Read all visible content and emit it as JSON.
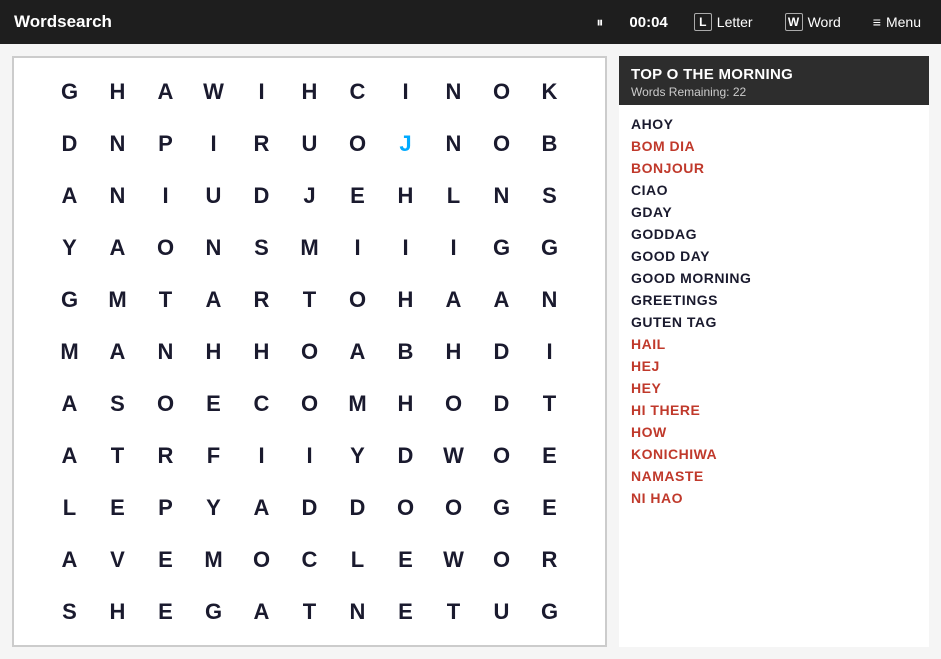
{
  "header": {
    "app_title": "Wordsearch",
    "pause_icon": "⏸",
    "timer": "00:04",
    "letter_label": "Letter",
    "letter_icon": "L",
    "word_label": "Word",
    "word_icon": "W",
    "menu_label": "Menu",
    "menu_icon": "≡"
  },
  "puzzle": {
    "title": "TOP O THE MORNING",
    "words_remaining_label": "Words Remaining: 22"
  },
  "grid": [
    [
      "G",
      "H",
      "A",
      "W",
      "I",
      "H",
      "C",
      "I",
      "N",
      "O",
      "K"
    ],
    [
      "D",
      "N",
      "P",
      "I",
      "R",
      "U",
      "O",
      "J",
      "N",
      "O",
      "B"
    ],
    [
      "A",
      "N",
      "I",
      "U",
      "D",
      "J",
      "E",
      "H",
      "L",
      "N",
      "S"
    ],
    [
      "Y",
      "A",
      "O",
      "N",
      "S",
      "M",
      "I",
      "I",
      "I",
      "G",
      "G"
    ],
    [
      "G",
      "M",
      "T",
      "A",
      "R",
      "T",
      "O",
      "H",
      "A",
      "A",
      "N"
    ],
    [
      "M",
      "A",
      "N",
      "H",
      "H",
      "O",
      "A",
      "B",
      "H",
      "D",
      "I"
    ],
    [
      "A",
      "S",
      "O",
      "E",
      "C",
      "O",
      "M",
      "H",
      "O",
      "D",
      "T"
    ],
    [
      "A",
      "T",
      "R",
      "F",
      "I",
      "I",
      "Y",
      "D",
      "W",
      "O",
      "E"
    ],
    [
      "L",
      "E",
      "P",
      "Y",
      "A",
      "D",
      "D",
      "O",
      "O",
      "G",
      "E"
    ],
    [
      "A",
      "V",
      "E",
      "M",
      "O",
      "C",
      "L",
      "E",
      "W",
      "O",
      "R"
    ],
    [
      "S",
      "H",
      "E",
      "G",
      "A",
      "T",
      "N",
      "E",
      "T",
      "U",
      "G"
    ]
  ],
  "highlight_cells": [
    [
      1,
      7
    ]
  ],
  "words": [
    {
      "text": "AHOY",
      "status": "unfound-dark"
    },
    {
      "text": "BOM DIA",
      "status": "unfound-red"
    },
    {
      "text": "BONJOUR",
      "status": "unfound-red"
    },
    {
      "text": "CIAO",
      "status": "unfound-dark"
    },
    {
      "text": "GDAY",
      "status": "unfound-dark"
    },
    {
      "text": "GODDAG",
      "status": "unfound-dark"
    },
    {
      "text": "GOOD DAY",
      "status": "unfound-dark"
    },
    {
      "text": "GOOD MORNING",
      "status": "unfound-dark"
    },
    {
      "text": "GREETINGS",
      "status": "unfound-dark"
    },
    {
      "text": "GUTEN TAG",
      "status": "unfound-dark"
    },
    {
      "text": "HAIL",
      "status": "unfound-red"
    },
    {
      "text": "HEJ",
      "status": "unfound-red"
    },
    {
      "text": "HEY",
      "status": "unfound-red"
    },
    {
      "text": "HI THERE",
      "status": "unfound-red"
    },
    {
      "text": "HOW",
      "status": "unfound-red"
    },
    {
      "text": "KONICHIWA",
      "status": "unfound-red"
    },
    {
      "text": "NAMASTE",
      "status": "unfound-red"
    },
    {
      "text": "NI HAO",
      "status": "unfound-red"
    }
  ]
}
